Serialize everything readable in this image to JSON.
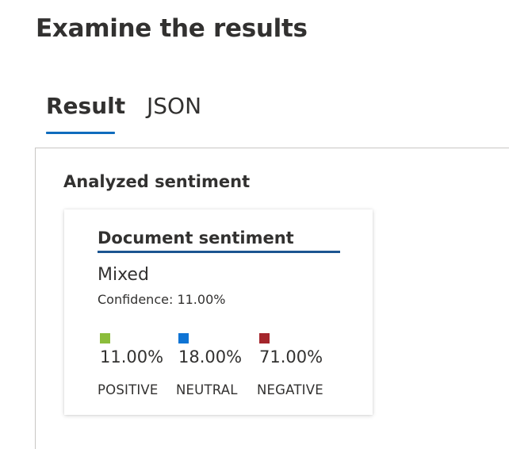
{
  "page": {
    "title": "Examine the results"
  },
  "tabs": [
    {
      "label": "Result",
      "active": true
    },
    {
      "label": "JSON",
      "active": false
    }
  ],
  "section": {
    "title": "Analyzed sentiment"
  },
  "card": {
    "title": "Document sentiment",
    "sentiment": "Mixed",
    "confidence": "Confidence: 11.00%",
    "scores": [
      {
        "value": "11.00%",
        "label": "POSITIVE",
        "color": "#8cbd3b"
      },
      {
        "value": "18.00%",
        "label": "NEUTRAL",
        "color": "#0f74d4"
      },
      {
        "value": "71.00%",
        "label": "NEGATIVE",
        "color": "#a4262c"
      }
    ]
  },
  "colors": {
    "accent": "#0f6cbd",
    "card_underline": "#1c5591"
  }
}
